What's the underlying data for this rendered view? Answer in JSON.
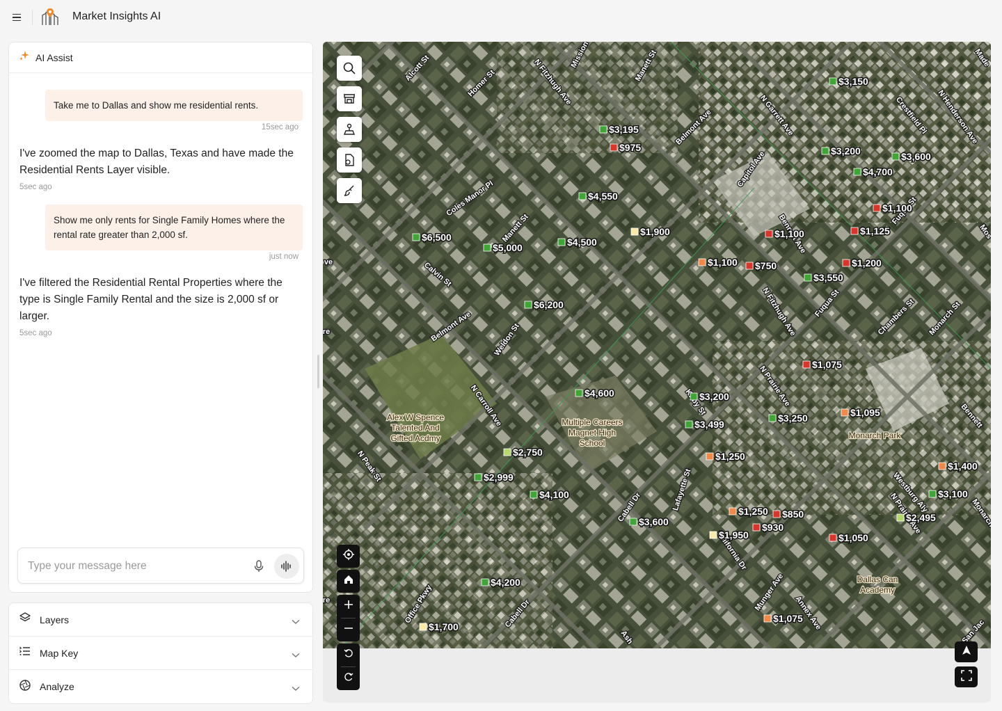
{
  "app": {
    "title": "Market Insights AI"
  },
  "chat": {
    "title": "AI Assist",
    "messages": [
      {
        "role": "user",
        "text": "Take me to Dallas and show me residential rents.",
        "time": "15sec ago"
      },
      {
        "role": "ai",
        "text": "I've zoomed the map to Dallas, Texas and have made the Residential Rents Layer visible.",
        "time": "5sec ago"
      },
      {
        "role": "user",
        "text": "Show me only rents for Single Family Homes where the rental rate greater than 2,000 sf.",
        "time": "just now"
      },
      {
        "role": "ai",
        "text": "I've filtered the Residential Rental Properties where the type is Single Family Rental and the size is 2,000 sf or larger.",
        "time": "5sec ago"
      }
    ],
    "input": {
      "placeholder": "Type your message here",
      "value": ""
    }
  },
  "panels": [
    {
      "label": "Layers",
      "icon": "layers-icon"
    },
    {
      "label": "Map Key",
      "icon": "list-icon"
    },
    {
      "label": "Analyze",
      "icon": "aperture-icon"
    }
  ],
  "map": {
    "tools": [
      "search-icon",
      "storefront-icon",
      "map-pin-icon",
      "file-map-icon",
      "brush-icon"
    ],
    "controls": [
      "locate-icon",
      "home-icon",
      "zoom-in-icon",
      "zoom-out-icon",
      "undo-icon",
      "redo-icon",
      "compass-icon",
      "fullscreen-icon"
    ],
    "colors": {
      "green": "#3fa535",
      "light_green": "#b5d96a",
      "yellow": "#fbe9a8",
      "orange": "#f08a4b",
      "red": "#d9352b"
    },
    "streets": [
      "Alcott St",
      "Homer St",
      "N Fitzhugh Ave",
      "Mission",
      "Manett St",
      "Belmont Ave",
      "N Garrett Ave",
      "Crestfield Pl",
      "N Henderson Ave",
      "Made",
      "Capitol Ave",
      "Coles Manor Pl",
      "Manett St",
      "Bennett Ave",
      "Fuqua St",
      "Mos",
      "ve",
      "Calvin St",
      "N Fitzhugh Ave",
      "Fuqua St",
      "Chambers St",
      "Monarch St",
      "Belmont Ave",
      "Weldon St",
      "N Prairie Ave",
      "N Carroll Ave",
      "Kirby St",
      "Bennett",
      "N Peak St",
      "Westburg Aly",
      "N Prairie Ave",
      "Monarch St",
      "Lafayette St",
      "Cabell Dr",
      "Munger Ave",
      "California Dr",
      "Munger Ave",
      "Annex Ave",
      "Office Pkwy",
      "Cabell Dr",
      "Ash",
      "San Jac",
      "re",
      "re"
    ],
    "pois": [
      "Alex W Spence Talented And Gifted Acdmy",
      "Multiple Careers Magnet High School",
      "Monarch Park",
      "Dallas Can Academy"
    ],
    "prices": [
      {
        "label": "$3,150",
        "color": "green"
      },
      {
        "label": "$3,195",
        "color": "green"
      },
      {
        "label": "$975",
        "color": "red"
      },
      {
        "label": "$3,200",
        "color": "green"
      },
      {
        "label": "$3,600",
        "color": "green"
      },
      {
        "label": "$4,700",
        "color": "green"
      },
      {
        "label": "$4,550",
        "color": "green"
      },
      {
        "label": "$1,100",
        "color": "red"
      },
      {
        "label": "$6,500",
        "color": "green"
      },
      {
        "label": "$5,000",
        "color": "green"
      },
      {
        "label": "$4,500",
        "color": "green"
      },
      {
        "label": "$1,900",
        "color": "yellow"
      },
      {
        "label": "$1,100",
        "color": "red"
      },
      {
        "label": "$1,125",
        "color": "red"
      },
      {
        "label": "$1,100",
        "color": "orange"
      },
      {
        "label": "$750",
        "color": "red"
      },
      {
        "label": "$1,200",
        "color": "red"
      },
      {
        "label": "$3,550",
        "color": "green"
      },
      {
        "label": "$6,200",
        "color": "green"
      },
      {
        "label": "$1,075",
        "color": "red"
      },
      {
        "label": "$4,600",
        "color": "green"
      },
      {
        "label": "$3,200",
        "color": "green"
      },
      {
        "label": "$3,250",
        "color": "green"
      },
      {
        "label": "$1,095",
        "color": "orange"
      },
      {
        "label": "$3,499",
        "color": "green"
      },
      {
        "label": "$1,250",
        "color": "orange"
      },
      {
        "label": "$1,400",
        "color": "orange"
      },
      {
        "label": "$2,750",
        "color": "light_green"
      },
      {
        "label": "$2,999",
        "color": "green"
      },
      {
        "label": "$4,100",
        "color": "green"
      },
      {
        "label": "$3,100",
        "color": "green"
      },
      {
        "label": "$3,600",
        "color": "green"
      },
      {
        "label": "$1,250",
        "color": "orange"
      },
      {
        "label": "$850",
        "color": "red"
      },
      {
        "label": "$2,495",
        "color": "light_green"
      },
      {
        "label": "$1,950",
        "color": "yellow"
      },
      {
        "label": "$930",
        "color": "red"
      },
      {
        "label": "$1,050",
        "color": "red"
      },
      {
        "label": "$4,200",
        "color": "green"
      },
      {
        "label": "$1,075",
        "color": "orange"
      },
      {
        "label": "$1,700",
        "color": "yellow"
      }
    ]
  }
}
